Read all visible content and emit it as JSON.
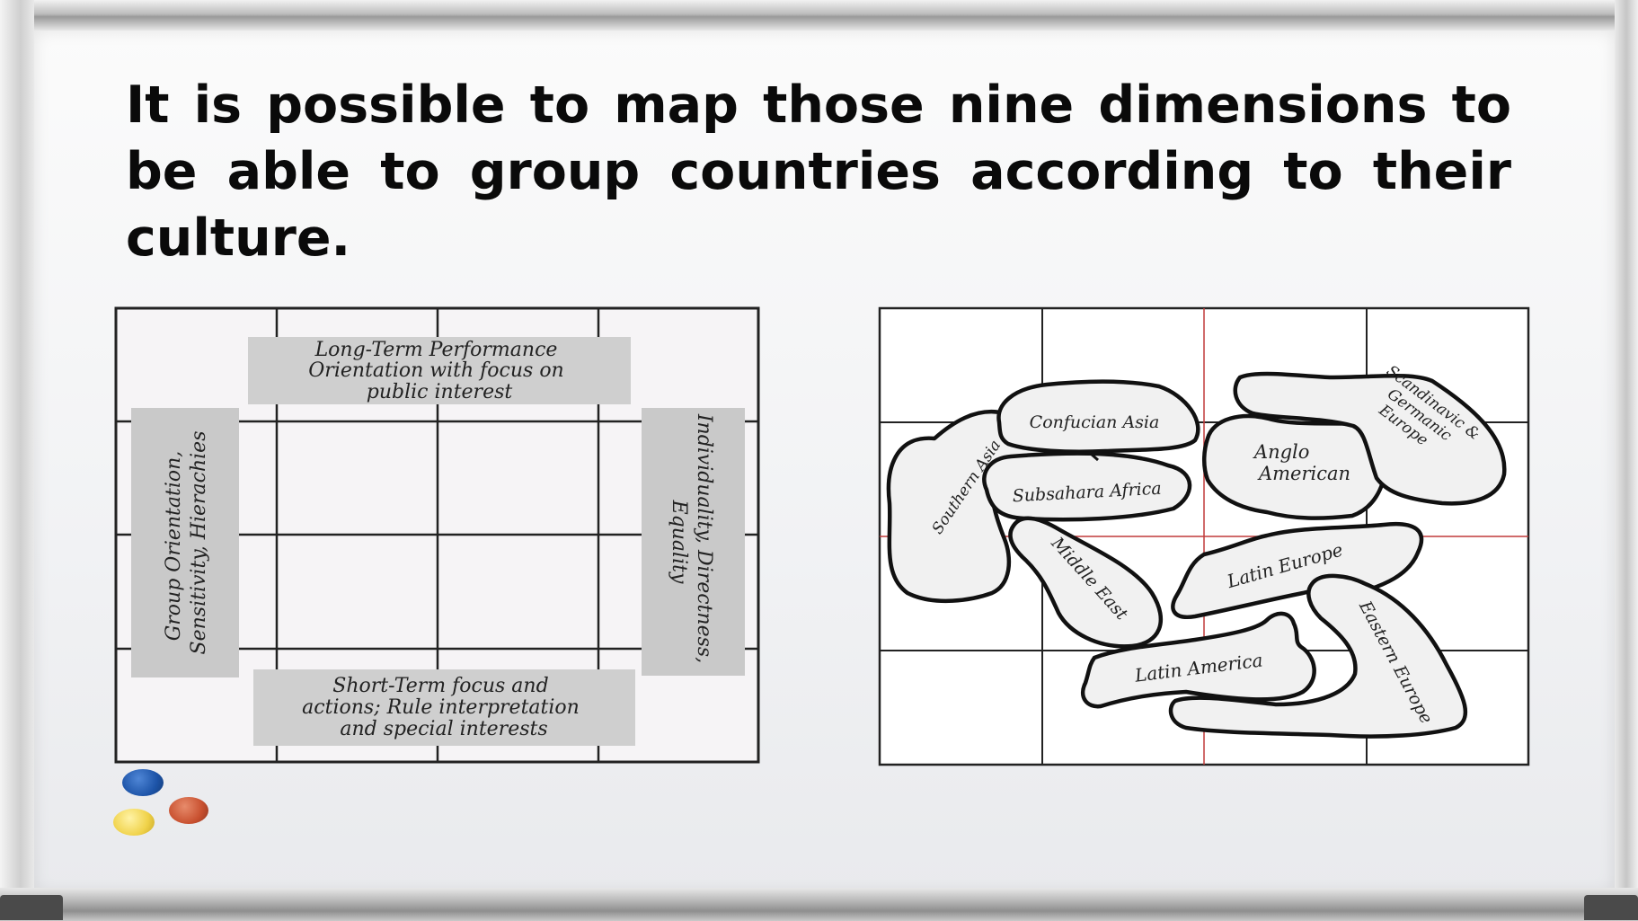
{
  "slide": {
    "title": "It is possible to map those nine dimensions to be able to group countries according to their culture."
  },
  "dimensions_grid": {
    "top_label_lines": [
      "Long-Term Performance",
      "Orientation with focus on",
      "public interest"
    ],
    "bottom_label_lines": [
      "Short-Term focus and",
      "actions; Rule interpretation",
      "and special interests"
    ],
    "left_label_lines": [
      "Group Orientation,",
      "Sensitivity, Hierachies"
    ],
    "right_label_lines": [
      "Individuality, Directness,",
      "Equality"
    ]
  },
  "culture_map": {
    "clusters": [
      {
        "id": "confucian-asia",
        "label": "Confucian Asia"
      },
      {
        "id": "southern-asia",
        "label": "Southern Asia"
      },
      {
        "id": "subsahara-africa",
        "label": "Subsahara Africa"
      },
      {
        "id": "middle-east",
        "label": "Middle East"
      },
      {
        "id": "anglo-american",
        "label_lines": [
          "Anglo",
          "American"
        ]
      },
      {
        "id": "scandinavic-germanic-europe",
        "label_lines": [
          "Scandinavic &",
          "Germanic",
          "Europe"
        ]
      },
      {
        "id": "latin-europe",
        "label": "Latin Europe"
      },
      {
        "id": "latin-america",
        "label": "Latin America"
      },
      {
        "id": "eastern-europe",
        "label": "Eastern Europe"
      }
    ]
  },
  "magnets": {
    "colors": {
      "blue": "#1d54a8",
      "red": "#c8502f",
      "yellow": "#f0d24a"
    }
  }
}
